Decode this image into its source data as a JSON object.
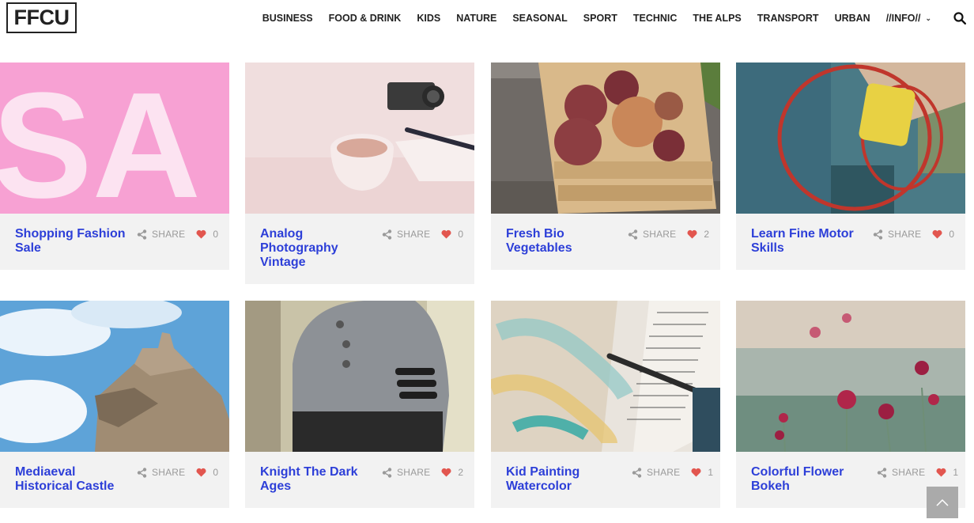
{
  "brand": {
    "logo_text": "FFCU"
  },
  "nav": {
    "items": [
      "BUSINESS",
      "FOOD & DRINK",
      "KIDS",
      "NATURE",
      "SEASONAL",
      "SPORT",
      "TECHNIC",
      "THE ALPS",
      "TRANSPORT",
      "URBAN"
    ],
    "info_label": "//INFO//"
  },
  "share_label": "SHARE",
  "posts": [
    {
      "title": "Shopping Fashion Sale",
      "likes": "0"
    },
    {
      "title": "Analog Photography Vintage",
      "likes": "0"
    },
    {
      "title": "Fresh Bio Vegetables",
      "likes": "2"
    },
    {
      "title": "Learn Fine Motor Skills",
      "likes": "0"
    },
    {
      "title": "Mediaeval Historical Castle",
      "likes": "0"
    },
    {
      "title": "Knight The Dark Ages",
      "likes": "2"
    },
    {
      "title": "Kid Painting Watercolor",
      "likes": "1"
    },
    {
      "title": "Colorful Flower Bokeh",
      "likes": "1"
    }
  ],
  "colors": {
    "title_blue": "#2d3fd8",
    "heart_red": "#e2564f",
    "card_bg": "#f2f2f2"
  }
}
